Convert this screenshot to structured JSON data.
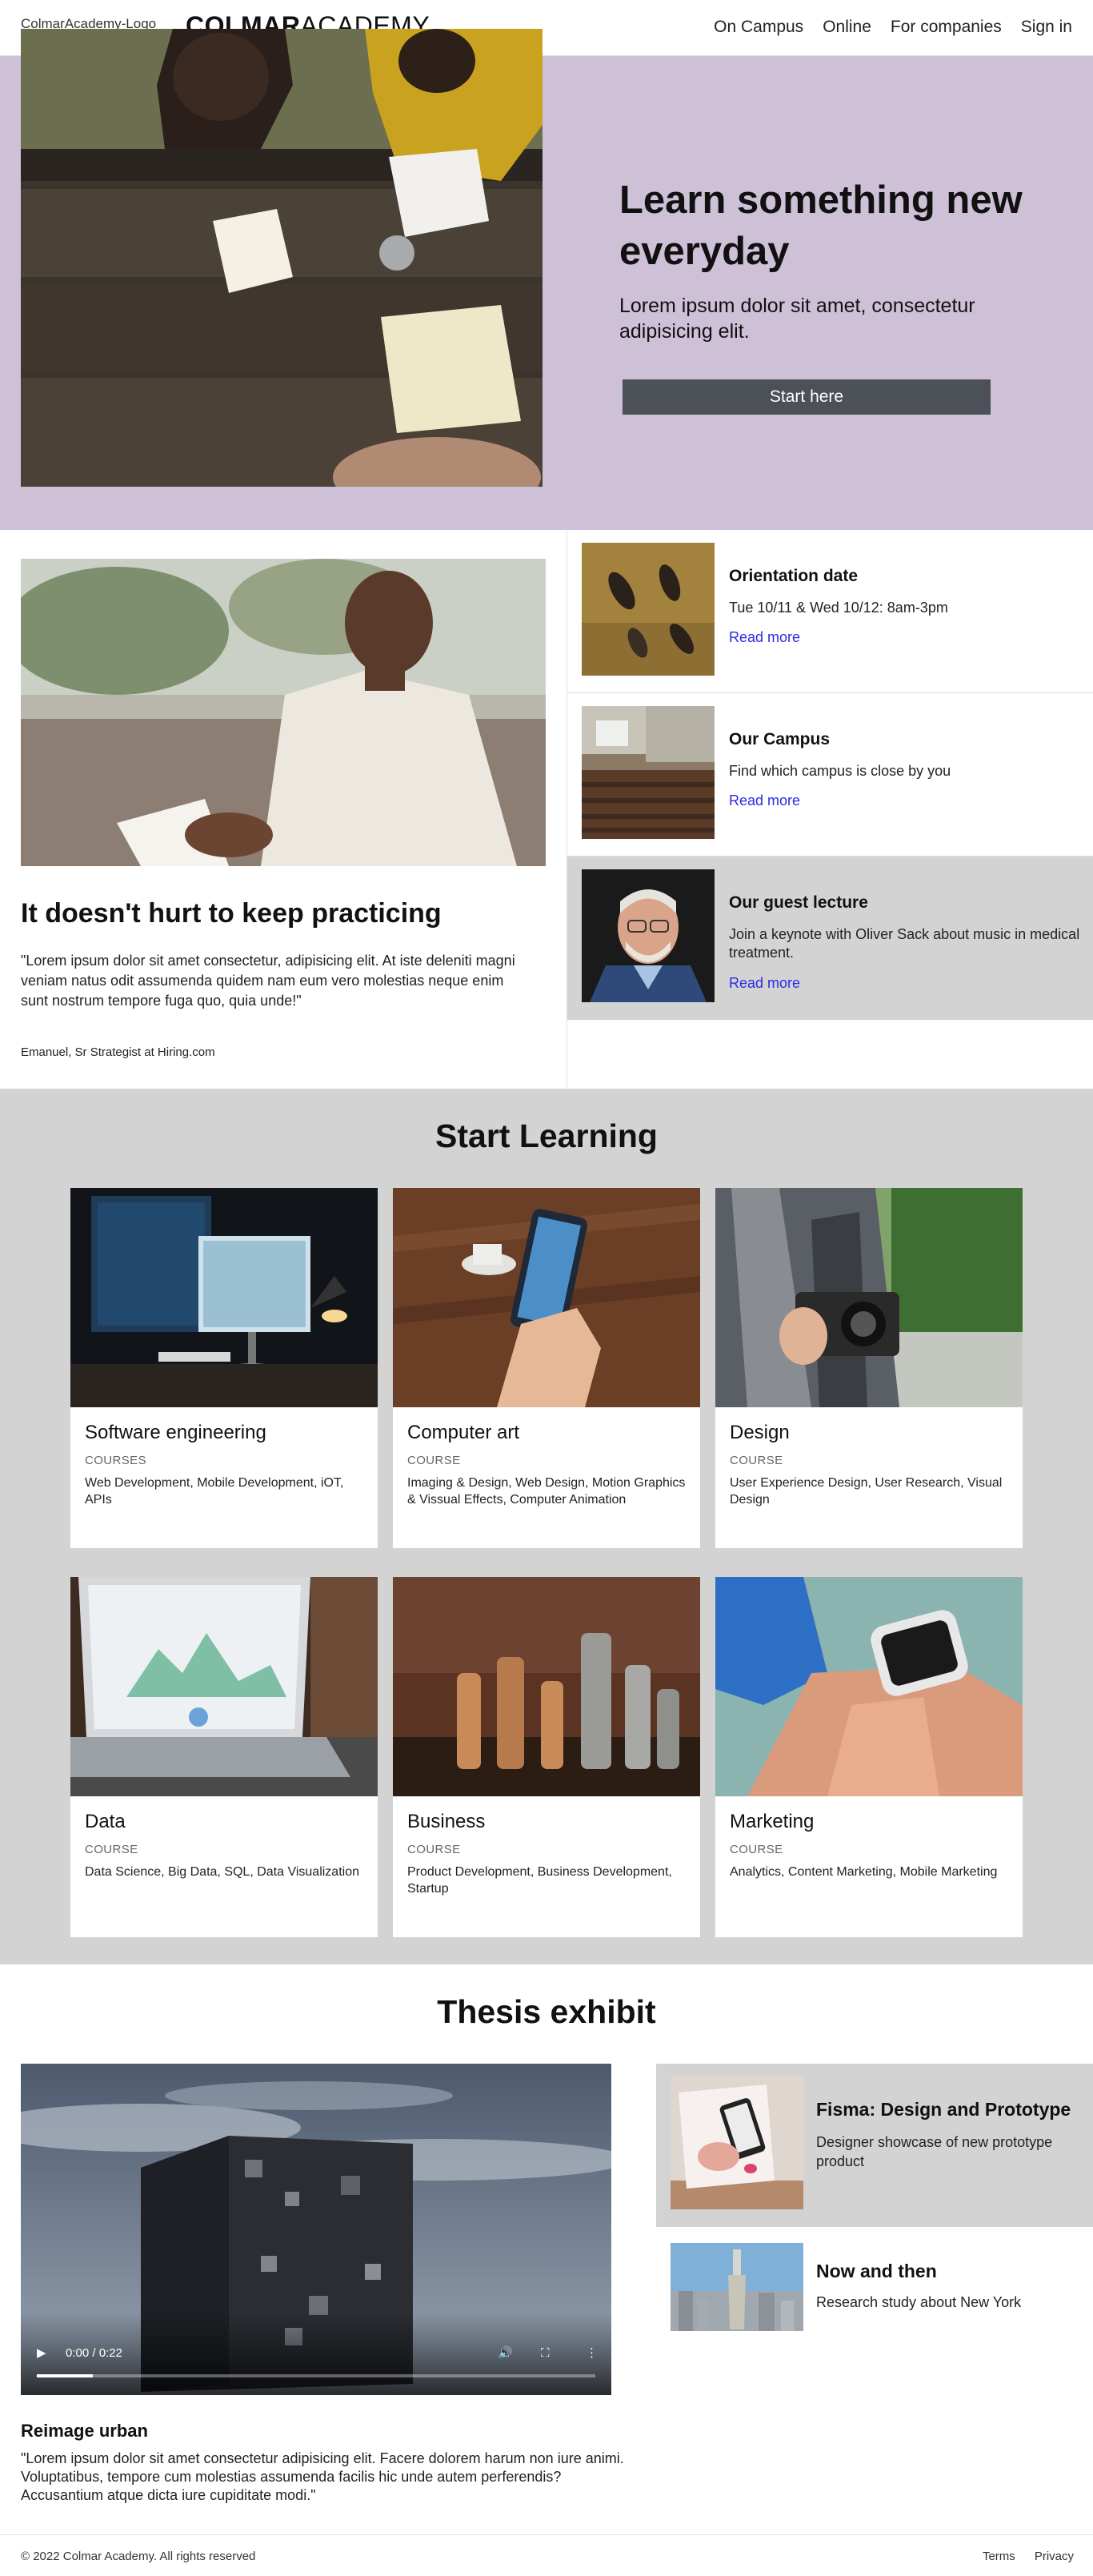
{
  "header": {
    "logo_alt": "ColmarAcademy-Logo",
    "brand_bold": "COLMAR",
    "brand_light": "ACADEMY",
    "nav": [
      "On Campus",
      "Online",
      "For companies",
      "Sign in"
    ]
  },
  "hero": {
    "title": "Learn something new everyday",
    "subtitle": "Lorem ipsum dolor sit amet, consectetur adipisicing elit.",
    "button": "Start here",
    "background_color": "#cdc0d7"
  },
  "practice": {
    "title": "It doesn't hurt to keep practicing",
    "quote": "\"Lorem ipsum dolor sit amet consectetur, adipisicing elit. At iste deleniti magni veniam natus odit assumenda quidem nam eum vero molestias neque enim sunt nostrum tempore fuga quo, quia unde!\"",
    "author": "Emanuel, Sr Strategist at Hiring.com"
  },
  "info_cards": [
    {
      "title": "Orientation date",
      "text": "Tue 10/11 & Wed 10/12: 8am-3pm",
      "link": "Read more"
    },
    {
      "title": "Our Campus",
      "text": "Find which campus is close by you",
      "link": "Read more"
    },
    {
      "title": "Our guest lecture",
      "text": "Join a keynote with Oliver Sack about music in medical treatment.",
      "link": "Read more"
    }
  ],
  "learning": {
    "title": "Start Learning",
    "courses": [
      {
        "title": "Software engineering",
        "tag": "COURSES",
        "desc": "Web Development, Mobile Development, iOT, APIs"
      },
      {
        "title": "Computer art",
        "tag": "COURSE",
        "desc": "Imaging & Design, Web Design, Motion Graphics & Vissual Effects, Computer Animation"
      },
      {
        "title": "Design",
        "tag": "COURSE",
        "desc": "User Experience Design, User Research, Visual Design"
      },
      {
        "title": "Data",
        "tag": "COURSE",
        "desc": "Data Science, Big Data, SQL, Data Visualization"
      },
      {
        "title": "Business",
        "tag": "COURSE",
        "desc": "Product Development, Business Development, Startup"
      },
      {
        "title": "Marketing",
        "tag": "COURSE",
        "desc": "Analytics, Content Marketing, Mobile Marketing"
      }
    ]
  },
  "thesis": {
    "title": "Thesis exhibit",
    "video": {
      "time": "0:00 / 0:22",
      "progress": 0.1
    },
    "main_title": "Reimage urban",
    "main_quote": "\"Lorem ipsum dolor sit amet consectetur adipisicing elit. Facere dolorem harum non iure animi. Voluptatibus, tempore cum molestias assumenda facilis hic unde autem perferendis? Accusantium atque dicta iure cupiditate modi.\"",
    "items": [
      {
        "title": "Fisma: Design and Prototype",
        "text": "Designer showcase of new prototype product"
      },
      {
        "title": "Now and then",
        "text": "Research study about New York"
      }
    ]
  },
  "footer": {
    "copyright": "© 2022 Colmar Academy. All rights reserved",
    "links": [
      "Terms",
      "Privacy"
    ]
  }
}
